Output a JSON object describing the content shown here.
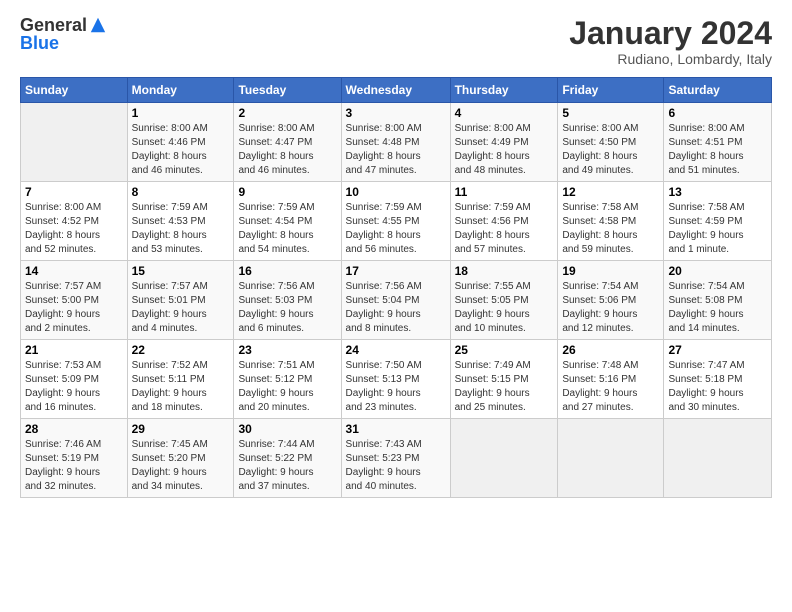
{
  "logo": {
    "general": "General",
    "blue": "Blue"
  },
  "header": {
    "title": "January 2024",
    "subtitle": "Rudiano, Lombardy, Italy"
  },
  "columns": [
    "Sunday",
    "Monday",
    "Tuesday",
    "Wednesday",
    "Thursday",
    "Friday",
    "Saturday"
  ],
  "weeks": [
    [
      {
        "day": "",
        "info": ""
      },
      {
        "day": "1",
        "info": "Sunrise: 8:00 AM\nSunset: 4:46 PM\nDaylight: 8 hours\nand 46 minutes."
      },
      {
        "day": "2",
        "info": "Sunrise: 8:00 AM\nSunset: 4:47 PM\nDaylight: 8 hours\nand 46 minutes."
      },
      {
        "day": "3",
        "info": "Sunrise: 8:00 AM\nSunset: 4:48 PM\nDaylight: 8 hours\nand 47 minutes."
      },
      {
        "day": "4",
        "info": "Sunrise: 8:00 AM\nSunset: 4:49 PM\nDaylight: 8 hours\nand 48 minutes."
      },
      {
        "day": "5",
        "info": "Sunrise: 8:00 AM\nSunset: 4:50 PM\nDaylight: 8 hours\nand 49 minutes."
      },
      {
        "day": "6",
        "info": "Sunrise: 8:00 AM\nSunset: 4:51 PM\nDaylight: 8 hours\nand 51 minutes."
      }
    ],
    [
      {
        "day": "7",
        "info": "Sunrise: 8:00 AM\nSunset: 4:52 PM\nDaylight: 8 hours\nand 52 minutes."
      },
      {
        "day": "8",
        "info": "Sunrise: 7:59 AM\nSunset: 4:53 PM\nDaylight: 8 hours\nand 53 minutes."
      },
      {
        "day": "9",
        "info": "Sunrise: 7:59 AM\nSunset: 4:54 PM\nDaylight: 8 hours\nand 54 minutes."
      },
      {
        "day": "10",
        "info": "Sunrise: 7:59 AM\nSunset: 4:55 PM\nDaylight: 8 hours\nand 56 minutes."
      },
      {
        "day": "11",
        "info": "Sunrise: 7:59 AM\nSunset: 4:56 PM\nDaylight: 8 hours\nand 57 minutes."
      },
      {
        "day": "12",
        "info": "Sunrise: 7:58 AM\nSunset: 4:58 PM\nDaylight: 8 hours\nand 59 minutes."
      },
      {
        "day": "13",
        "info": "Sunrise: 7:58 AM\nSunset: 4:59 PM\nDaylight: 9 hours\nand 1 minute."
      }
    ],
    [
      {
        "day": "14",
        "info": "Sunrise: 7:57 AM\nSunset: 5:00 PM\nDaylight: 9 hours\nand 2 minutes."
      },
      {
        "day": "15",
        "info": "Sunrise: 7:57 AM\nSunset: 5:01 PM\nDaylight: 9 hours\nand 4 minutes."
      },
      {
        "day": "16",
        "info": "Sunrise: 7:56 AM\nSunset: 5:03 PM\nDaylight: 9 hours\nand 6 minutes."
      },
      {
        "day": "17",
        "info": "Sunrise: 7:56 AM\nSunset: 5:04 PM\nDaylight: 9 hours\nand 8 minutes."
      },
      {
        "day": "18",
        "info": "Sunrise: 7:55 AM\nSunset: 5:05 PM\nDaylight: 9 hours\nand 10 minutes."
      },
      {
        "day": "19",
        "info": "Sunrise: 7:54 AM\nSunset: 5:06 PM\nDaylight: 9 hours\nand 12 minutes."
      },
      {
        "day": "20",
        "info": "Sunrise: 7:54 AM\nSunset: 5:08 PM\nDaylight: 9 hours\nand 14 minutes."
      }
    ],
    [
      {
        "day": "21",
        "info": "Sunrise: 7:53 AM\nSunset: 5:09 PM\nDaylight: 9 hours\nand 16 minutes."
      },
      {
        "day": "22",
        "info": "Sunrise: 7:52 AM\nSunset: 5:11 PM\nDaylight: 9 hours\nand 18 minutes."
      },
      {
        "day": "23",
        "info": "Sunrise: 7:51 AM\nSunset: 5:12 PM\nDaylight: 9 hours\nand 20 minutes."
      },
      {
        "day": "24",
        "info": "Sunrise: 7:50 AM\nSunset: 5:13 PM\nDaylight: 9 hours\nand 23 minutes."
      },
      {
        "day": "25",
        "info": "Sunrise: 7:49 AM\nSunset: 5:15 PM\nDaylight: 9 hours\nand 25 minutes."
      },
      {
        "day": "26",
        "info": "Sunrise: 7:48 AM\nSunset: 5:16 PM\nDaylight: 9 hours\nand 27 minutes."
      },
      {
        "day": "27",
        "info": "Sunrise: 7:47 AM\nSunset: 5:18 PM\nDaylight: 9 hours\nand 30 minutes."
      }
    ],
    [
      {
        "day": "28",
        "info": "Sunrise: 7:46 AM\nSunset: 5:19 PM\nDaylight: 9 hours\nand 32 minutes."
      },
      {
        "day": "29",
        "info": "Sunrise: 7:45 AM\nSunset: 5:20 PM\nDaylight: 9 hours\nand 34 minutes."
      },
      {
        "day": "30",
        "info": "Sunrise: 7:44 AM\nSunset: 5:22 PM\nDaylight: 9 hours\nand 37 minutes."
      },
      {
        "day": "31",
        "info": "Sunrise: 7:43 AM\nSunset: 5:23 PM\nDaylight: 9 hours\nand 40 minutes."
      },
      {
        "day": "",
        "info": ""
      },
      {
        "day": "",
        "info": ""
      },
      {
        "day": "",
        "info": ""
      }
    ]
  ]
}
